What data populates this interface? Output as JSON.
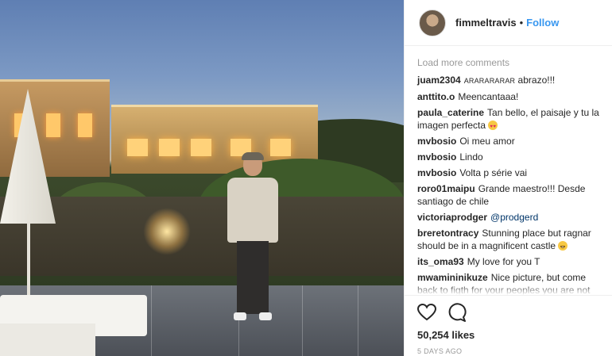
{
  "post": {
    "username": "fimmeltravis",
    "follow_label": "Follow",
    "load_more": "Load more comments",
    "comments": [
      {
        "user": "juam2304",
        "small_text": "ARARARARAR",
        "text": " abrazo!!!"
      },
      {
        "user": "anttito.o",
        "text": "Meencantaaa!"
      },
      {
        "user": "paula_caterine",
        "text": "Tan bello, el paisaje y tu la imagen perfecta ",
        "emoji": "heart-eyes"
      },
      {
        "user": "mvbosio",
        "text": "Oi meu amor"
      },
      {
        "user": "mvbosio",
        "text": "Lindo"
      },
      {
        "user": "mvbosio",
        "text": "Volta p série vai"
      },
      {
        "user": "roro01maipu",
        "text": "Grande maestro!!! Desde santiago de chile"
      },
      {
        "user": "victoriaprodger",
        "mention": "@prodgerd"
      },
      {
        "user": "breretontracy",
        "text": "Stunning place but ragnar should be in a magnificent castle ",
        "emoji": "grin"
      },
      {
        "user": "its_oma93",
        "text": "My love for you T"
      },
      {
        "user": "mwamininikuze",
        "text": "Nice picture, but come back to figth for your peoples you are not"
      }
    ],
    "likes": "50,254 likes",
    "time_ago": "5 DAYS AGO",
    "icons": [
      "heart-icon",
      "comment-icon"
    ],
    "colors": {
      "link": "#3897f0",
      "muted": "#999999",
      "text": "#262626"
    }
  }
}
